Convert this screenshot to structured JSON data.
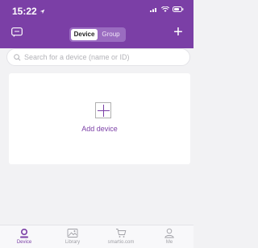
{
  "status_bar": {
    "time": "15:22"
  },
  "header": {
    "tabs": [
      {
        "label": "Device",
        "active": true
      },
      {
        "label": "Group",
        "active": false
      }
    ]
  },
  "search": {
    "placeholder": "Search for a device (name or ID)"
  },
  "device_card": {
    "add_label": "Add device"
  },
  "tab_bar": {
    "items": [
      {
        "label": "Device",
        "icon": "device-icon",
        "active": true
      },
      {
        "label": "Library",
        "icon": "image-icon",
        "active": false
      },
      {
        "label": "smartio.com",
        "icon": "cart-icon",
        "active": false
      },
      {
        "label": "Me",
        "icon": "user-icon",
        "active": false
      }
    ]
  },
  "colors": {
    "accent": "#7b3fa6",
    "background": "#f2f2f4"
  }
}
